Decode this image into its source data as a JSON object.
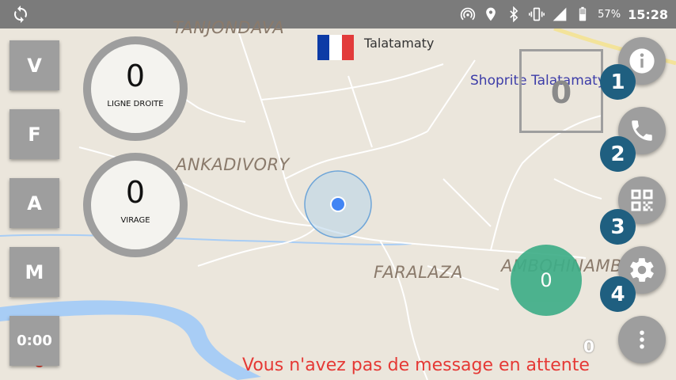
{
  "status_bar": {
    "sync_icon": "sync-icon",
    "icons": [
      "hotspot-icon",
      "location-icon",
      "bluetooth-icon",
      "vibrate-icon",
      "signal-icon",
      "battery-icon"
    ],
    "battery_percent": "57%",
    "time": "15:28"
  },
  "map": {
    "labels": {
      "top_village": "TANJONDAVA",
      "city": "Talatamaty",
      "shop": "Shoprite Talatamaty",
      "ankadivory": "ANKADIVORY",
      "faralaza": "FARALAZA",
      "ambohinambo": "AMBOHINAMBO"
    },
    "attribution": {
      "part1": "G",
      "part2": "o",
      "part3": "gle"
    },
    "colors": {
      "background": "#ebe6dc",
      "roads": "#ffffff",
      "river": "#a8cdf5",
      "location": "#4285f4"
    }
  },
  "left_buttons": [
    {
      "label": "V"
    },
    {
      "label": "F"
    },
    {
      "label": "A"
    },
    {
      "label": "M"
    }
  ],
  "timer": {
    "value": "0:00"
  },
  "gauges": {
    "straight": {
      "value": "0",
      "label": "LIGNE DROITE"
    },
    "turn": {
      "value": "0",
      "label": "VIRAGE"
    }
  },
  "frame_counter": {
    "value": "0"
  },
  "fabs": {
    "info": {
      "icon": "info-icon",
      "badge": "1"
    },
    "phone": {
      "icon": "phone-icon",
      "badge": "2"
    },
    "qr": {
      "icon": "qr-code-icon",
      "badge": "3"
    },
    "settings": {
      "icon": "gear-icon",
      "badge": "4"
    },
    "more": {
      "icon": "more-vertical-icon"
    }
  },
  "green_counter": {
    "value": "0",
    "color": "#3fae88"
  },
  "small_counter": {
    "value": "0"
  },
  "message": {
    "text": "Vous n'avez pas de message en attente",
    "color": "#e53935"
  }
}
